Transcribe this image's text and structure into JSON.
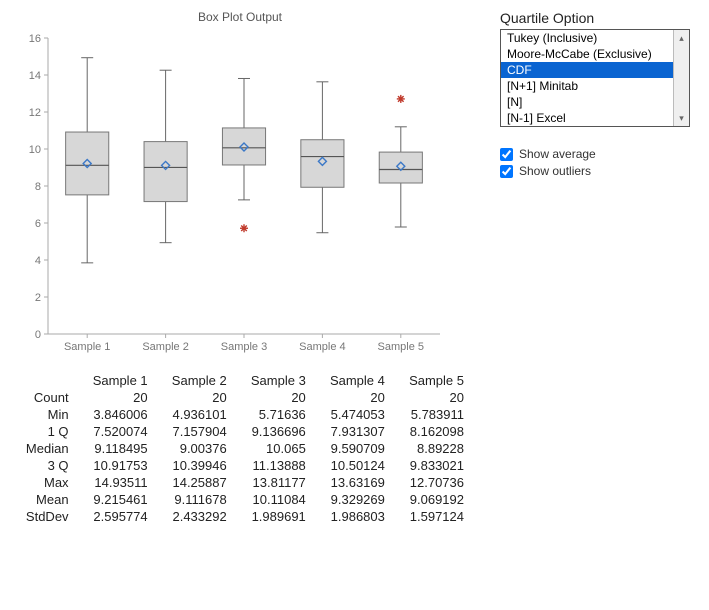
{
  "chart_data": {
    "type": "boxplot",
    "title": "Box Plot Output",
    "categories": [
      "Sample 1",
      "Sample 2",
      "Sample 3",
      "Sample 4",
      "Sample 5"
    ],
    "ylim": [
      0,
      16
    ],
    "yticks": [
      0,
      2,
      4,
      6,
      8,
      10,
      12,
      14,
      16
    ],
    "boxes": [
      {
        "min": 3.846006,
        "q1": 7.520074,
        "median": 9.118495,
        "q3": 10.91753,
        "max": 14.93511,
        "mean": 9.215461,
        "outliers": []
      },
      {
        "min": 4.936101,
        "q1": 7.157904,
        "median": 9.00376,
        "q3": 10.39946,
        "max": 14.25887,
        "mean": 9.111678,
        "outliers": []
      },
      {
        "min": 7.25,
        "q1": 9.136696,
        "median": 10.065,
        "q3": 11.13888,
        "max": 13.81177,
        "mean": 10.11084,
        "outliers": [
          5.71636
        ]
      },
      {
        "min": 5.474053,
        "q1": 7.931307,
        "median": 9.590709,
        "q3": 10.50124,
        "max": 13.63169,
        "mean": 9.329269,
        "outliers": []
      },
      {
        "min": 5.783911,
        "q1": 8.162098,
        "median": 8.89228,
        "q3": 9.833021,
        "max": 11.2,
        "mean": 9.069192,
        "outliers": [
          12.70736
        ]
      }
    ]
  },
  "stats": {
    "columns": [
      "Sample 1",
      "Sample 2",
      "Sample 3",
      "Sample 4",
      "Sample 5"
    ],
    "rows": [
      {
        "label": "Count",
        "values": [
          "20",
          "20",
          "20",
          "20",
          "20"
        ]
      },
      {
        "label": "Min",
        "values": [
          "3.846006",
          "4.936101",
          "5.71636",
          "5.474053",
          "5.783911"
        ]
      },
      {
        "label": "1 Q",
        "values": [
          "7.520074",
          "7.157904",
          "9.136696",
          "7.931307",
          "8.162098"
        ]
      },
      {
        "label": "Median",
        "values": [
          "9.118495",
          "9.00376",
          "10.065",
          "9.590709",
          "8.89228"
        ]
      },
      {
        "label": "3 Q",
        "values": [
          "10.91753",
          "10.39946",
          "11.13888",
          "10.50124",
          "9.833021"
        ]
      },
      {
        "label": "Max",
        "values": [
          "14.93511",
          "14.25887",
          "13.81177",
          "13.63169",
          "12.70736"
        ]
      },
      {
        "label": "Mean",
        "values": [
          "9.215461",
          "9.111678",
          "10.11084",
          "9.329269",
          "9.069192"
        ]
      },
      {
        "label": "StdDev",
        "values": [
          "2.595774",
          "2.433292",
          "1.989691",
          "1.986803",
          "1.597124"
        ]
      }
    ]
  },
  "options": {
    "label": "Quartile Option",
    "items": [
      "Tukey (Inclusive)",
      "Moore-McCabe (Exclusive)",
      "CDF",
      "[N+1] Minitab",
      "[N]",
      "[N-1] Excel"
    ],
    "selected_index": 2,
    "show_average_label": "Show average",
    "show_outliers_label": "Show outliers",
    "show_average": true,
    "show_outliers": true
  }
}
